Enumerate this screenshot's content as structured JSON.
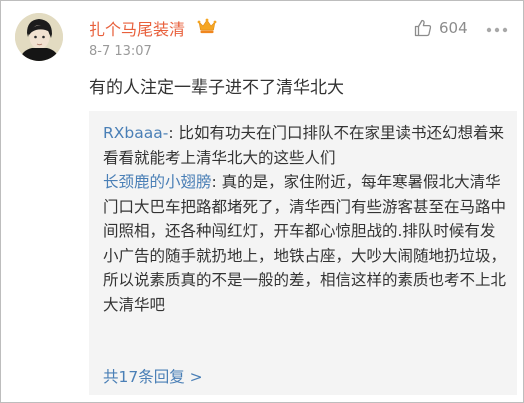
{
  "comment": {
    "username": "扎个马尾装清",
    "timestamp": "8-7 13:07",
    "like_count": "604",
    "text": "有的人注定一辈子进不了清华北大"
  },
  "replies": [
    {
      "author": "RXbaaa-",
      "text": "比如有功夫在门口排队不在家里读书还幻想着来看看就能考上清华北大的这些人们"
    },
    {
      "author": "长颈鹿的小翅膀",
      "text": "真的是，家住附近，每年寒暑假北大清华门口大巴车把路都堵死了，清华西门有些游客甚至在马路中间照相，还各种闯红灯，开车都心惊胆战的.排队时候有发小广告的随手就扔地上，地铁占座，大吵大闹随地扔垃圾，所以说素质真的不是一般的差，相信这样的素质也考不上北大清华吧"
    }
  ],
  "more_replies_label": "共17条回复 >",
  "icons": {
    "badge": "vip-crown-icon",
    "like": "thumbs-up-icon",
    "more": "more-dots-icon"
  },
  "colors": {
    "username": "#e8603c",
    "link": "#4a7fb6",
    "reply_background": "#f4f4f4",
    "muted": "#9a9a9a"
  }
}
